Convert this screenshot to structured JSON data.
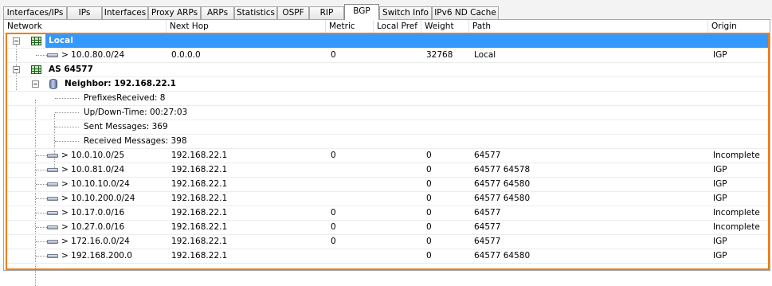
{
  "tabs": [
    {
      "label": "Interfaces/IPs"
    },
    {
      "label": "IPs"
    },
    {
      "label": "Interfaces"
    },
    {
      "label": "Proxy ARPs"
    },
    {
      "label": "ARPs"
    },
    {
      "label": "Statistics"
    },
    {
      "label": "OSPF"
    },
    {
      "label": "RIP"
    },
    {
      "label": "BGP"
    },
    {
      "label": "Switch Info"
    },
    {
      "label": "IPv6 ND Cache"
    }
  ],
  "active_tab": "BGP",
  "columns": {
    "network": "Network",
    "next_hop": "Next Hop",
    "metric": "Metric",
    "local_pref": "Local Pref",
    "weight": "Weight",
    "path": "Path",
    "origin": "Origin"
  },
  "tree": {
    "local": {
      "label": "Local",
      "route": {
        "network": "> 10.0.80.0/24",
        "next_hop": "0.0.0.0",
        "metric": "0",
        "local_pref": "",
        "weight": "32768",
        "path": "Local",
        "origin": "IGP"
      }
    },
    "as": {
      "label": "AS 64577",
      "neighbor": {
        "label": "Neighbor: 192.168.22.1",
        "details": [
          "PrefixesReceived: 8",
          "Up/Down-Time: 00:27:03",
          "Sent Messages: 369",
          "Received Messages: 398"
        ]
      },
      "routes": [
        {
          "network": "> 10.0.10.0/25",
          "next_hop": "192.168.22.1",
          "metric": "0",
          "local_pref": "",
          "weight": "0",
          "path": "64577",
          "origin": "Incomplete"
        },
        {
          "network": "> 10.0.81.0/24",
          "next_hop": "192.168.22.1",
          "metric": "",
          "local_pref": "",
          "weight": "0",
          "path": "64577 64578",
          "origin": "IGP"
        },
        {
          "network": "> 10.10.10.0/24",
          "next_hop": "192.168.22.1",
          "metric": "",
          "local_pref": "",
          "weight": "0",
          "path": "64577 64580",
          "origin": "IGP"
        },
        {
          "network": "> 10.10.200.0/24",
          "next_hop": "192.168.22.1",
          "metric": "",
          "local_pref": "",
          "weight": "0",
          "path": "64577 64580",
          "origin": "IGP"
        },
        {
          "network": "> 10.17.0.0/16",
          "next_hop": "192.168.22.1",
          "metric": "0",
          "local_pref": "",
          "weight": "0",
          "path": "64577",
          "origin": "Incomplete"
        },
        {
          "network": "> 10.27.0.0/16",
          "next_hop": "192.168.22.1",
          "metric": "0",
          "local_pref": "",
          "weight": "0",
          "path": "64577",
          "origin": "Incomplete"
        },
        {
          "network": "> 172.16.0.0/24",
          "next_hop": "192.168.22.1",
          "metric": "0",
          "local_pref": "",
          "weight": "0",
          "path": "64577",
          "origin": "IGP"
        },
        {
          "network": "> 192.168.200.0",
          "next_hop": "192.168.22.1",
          "metric": "",
          "local_pref": "",
          "weight": "0",
          "path": "64577 64580",
          "origin": "IGP"
        }
      ]
    }
  },
  "colors": {
    "selection": "#3399ff",
    "focus_border": "#f07d0f"
  }
}
